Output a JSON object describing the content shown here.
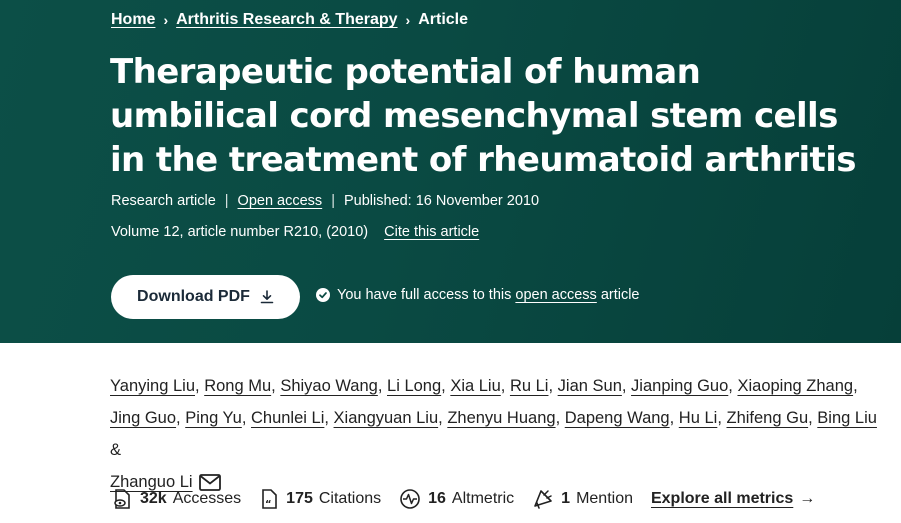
{
  "breadcrumb": {
    "items": [
      {
        "label": "Home"
      },
      {
        "label": "Arthritis Research & Therapy"
      },
      {
        "label": "Article"
      }
    ]
  },
  "article": {
    "title": "Therapeutic potential of human umbilical cord mesenchymal stem cells in the treatment of rheumatoid arthritis",
    "type": "Research article",
    "open_access": "Open access",
    "published": "Published: 16 November 2010",
    "volume": "Volume 12, article number R210, (2010)",
    "cite": "Cite this article"
  },
  "actions": {
    "download_pdf": "Download PDF",
    "access_prefix": "You have full access to this",
    "access_link": "open access",
    "access_suffix": "article"
  },
  "authors": {
    "list": [
      "Yanying Liu",
      "Rong Mu",
      "Shiyao Wang",
      "Li Long",
      "Xia Liu",
      "Ru Li",
      "Jian Sun",
      "Jianping Guo",
      "Xiaoping Zhang",
      "Jing Guo",
      "Ping Yu",
      "Chunlei Li",
      "Xiangyuan Liu",
      "Zhenyu Huang",
      "Dapeng Wang",
      "Hu Li",
      "Zhifeng Gu",
      "Bing Liu",
      "Zhanguo Li"
    ],
    "and": "&"
  },
  "metrics": {
    "accesses_value": "32k",
    "accesses_label": "Accesses",
    "citations_value": "175",
    "citations_label": "Citations",
    "altmetric_value": "16",
    "altmetric_label": "Altmetric",
    "mention_value": "1",
    "mention_label": "Mention",
    "explore": "Explore all metrics"
  },
  "colors": {
    "hero_bg": "#0a4a43",
    "text_dark": "#222222",
    "button_text": "#1b2a38"
  }
}
